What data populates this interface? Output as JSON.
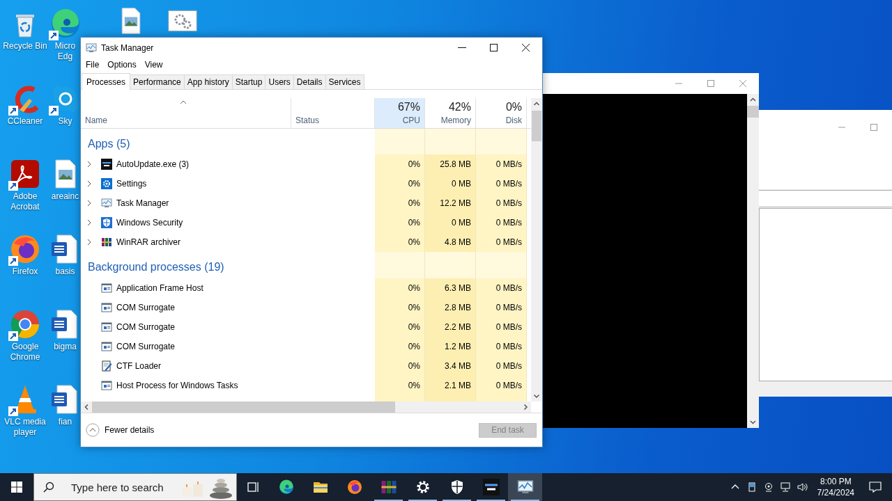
{
  "desktop": {
    "icons": [
      {
        "label": "Recycle Bin",
        "kind": "recyclebin",
        "shortcut": false
      },
      {
        "label": "CCleaner",
        "kind": "ccleaner",
        "shortcut": true
      },
      {
        "label": "Adobe Acrobat",
        "kind": "acrobat",
        "shortcut": true
      },
      {
        "label": "Firefox",
        "kind": "firefox",
        "shortcut": true
      },
      {
        "label": "Google Chrome",
        "kind": "chrome",
        "shortcut": true
      },
      {
        "label": "VLC media player",
        "kind": "vlc",
        "shortcut": true
      },
      {
        "label": "Micro Edg",
        "kind": "edge",
        "shortcut": true
      },
      {
        "label": "Sky",
        "kind": "skype",
        "shortcut": true
      },
      {
        "label": "areainc",
        "kind": "imagefile",
        "shortcut": false
      },
      {
        "label": "basis",
        "kind": "word",
        "shortcut": false
      },
      {
        "label": "bigma",
        "kind": "word",
        "shortcut": false
      },
      {
        "label": "fian",
        "kind": "word",
        "shortcut": false
      }
    ],
    "top_icons": [
      {
        "kind": "imagefile"
      },
      {
        "kind": "gearwindow"
      }
    ]
  },
  "task_manager": {
    "title": "Task Manager",
    "menu": [
      "File",
      "Options",
      "View"
    ],
    "tabs": [
      {
        "label": "Processes",
        "selected": true
      },
      {
        "label": "Performance",
        "selected": false
      },
      {
        "label": "App history",
        "selected": false
      },
      {
        "label": "Startup",
        "selected": false
      },
      {
        "label": "Users",
        "selected": false
      },
      {
        "label": "Details",
        "selected": false
      },
      {
        "label": "Services",
        "selected": false
      }
    ],
    "columns": {
      "name": "Name",
      "status": "Status",
      "metrics": [
        {
          "percent": "67%",
          "label": "CPU",
          "highlighted": true
        },
        {
          "percent": "42%",
          "label": "Memory",
          "highlighted": false
        },
        {
          "percent": "0%",
          "label": "Disk",
          "highlighted": false
        }
      ]
    },
    "groups": [
      {
        "title": "Apps (5)",
        "rows": [
          {
            "name": "AutoUpdate.exe (3)",
            "kind": "autoupdate",
            "expandable": true,
            "values": [
              "0%",
              "25.8 MB",
              "0 MB/s"
            ]
          },
          {
            "name": "Settings",
            "kind": "settings",
            "expandable": true,
            "values": [
              "0%",
              "0 MB",
              "0 MB/s"
            ]
          },
          {
            "name": "Task Manager",
            "kind": "taskmgr",
            "expandable": true,
            "values": [
              "0%",
              "12.2 MB",
              "0 MB/s"
            ]
          },
          {
            "name": "Windows Security",
            "kind": "security",
            "expandable": true,
            "values": [
              "0%",
              "0 MB",
              "0 MB/s"
            ]
          },
          {
            "name": "WinRAR archiver",
            "kind": "winrar",
            "expandable": true,
            "values": [
              "0%",
              "4.8 MB",
              "0 MB/s"
            ]
          }
        ]
      },
      {
        "title": "Background processes (19)",
        "rows": [
          {
            "name": "Application Frame Host",
            "kind": "appwindow",
            "expandable": false,
            "values": [
              "0%",
              "6.3 MB",
              "0 MB/s"
            ]
          },
          {
            "name": "COM Surrogate",
            "kind": "appwindow",
            "expandable": false,
            "values": [
              "0%",
              "2.8 MB",
              "0 MB/s"
            ]
          },
          {
            "name": "COM Surrogate",
            "kind": "appwindow",
            "expandable": false,
            "values": [
              "0%",
              "2.2 MB",
              "0 MB/s"
            ]
          },
          {
            "name": "COM Surrogate",
            "kind": "appwindow",
            "expandable": false,
            "values": [
              "0%",
              "1.2 MB",
              "0 MB/s"
            ]
          },
          {
            "name": "CTF Loader",
            "kind": "ctf",
            "expandable": false,
            "values": [
              "0%",
              "3.4 MB",
              "0 MB/s"
            ]
          },
          {
            "name": "Host Process for Windows Tasks",
            "kind": "appwindow",
            "expandable": false,
            "values": [
              "0%",
              "2.1 MB",
              "0 MB/s"
            ]
          }
        ]
      }
    ],
    "footer": {
      "toggle": "Fewer details",
      "end_task": {
        "label": "End task",
        "disabled": true
      }
    }
  },
  "taskbar": {
    "search": {
      "placeholder": "Type here to search"
    },
    "apps": [
      {
        "kind": "edge",
        "running": false,
        "active": false
      },
      {
        "kind": "folder",
        "running": false,
        "active": false
      },
      {
        "kind": "firefox",
        "running": false,
        "active": false
      },
      {
        "kind": "winrar",
        "running": true,
        "active": false
      },
      {
        "kind": "whitegear",
        "running": true,
        "active": false
      },
      {
        "kind": "whiteshield",
        "running": true,
        "active": false
      },
      {
        "kind": "autoupdate",
        "running": true,
        "active": false
      },
      {
        "kind": "taskmgr",
        "running": true,
        "active": true
      }
    ],
    "clock": {
      "time": "8:00 PM",
      "date": "7/24/2024"
    }
  }
}
